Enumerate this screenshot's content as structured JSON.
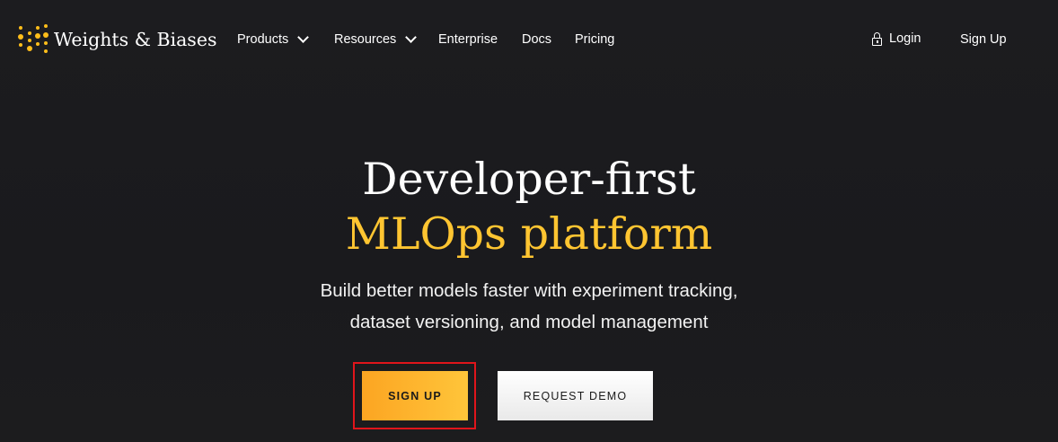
{
  "brand": {
    "name": "Weights & Biases",
    "accent_color": "#ffbe1a"
  },
  "nav": {
    "items": [
      {
        "label": "Products",
        "has_dropdown": true
      },
      {
        "label": "Resources",
        "has_dropdown": true
      },
      {
        "label": "Enterprise",
        "has_dropdown": false
      },
      {
        "label": "Docs",
        "has_dropdown": false
      },
      {
        "label": "Pricing",
        "has_dropdown": false
      }
    ],
    "login_label": "Login",
    "login_icon": "lock-icon",
    "signup_label": "Sign Up"
  },
  "hero": {
    "title_line1": "Developer-first",
    "title_line2": "MLOps platform",
    "title_line2_color": "#ffc531",
    "subtitle_line1": "Build better models faster with experiment tracking,",
    "subtitle_line2": "dataset versioning, and model management"
  },
  "cta": {
    "primary_label": "SIGN UP",
    "secondary_label": "REQUEST DEMO",
    "highlight_color": "#e0151b"
  }
}
